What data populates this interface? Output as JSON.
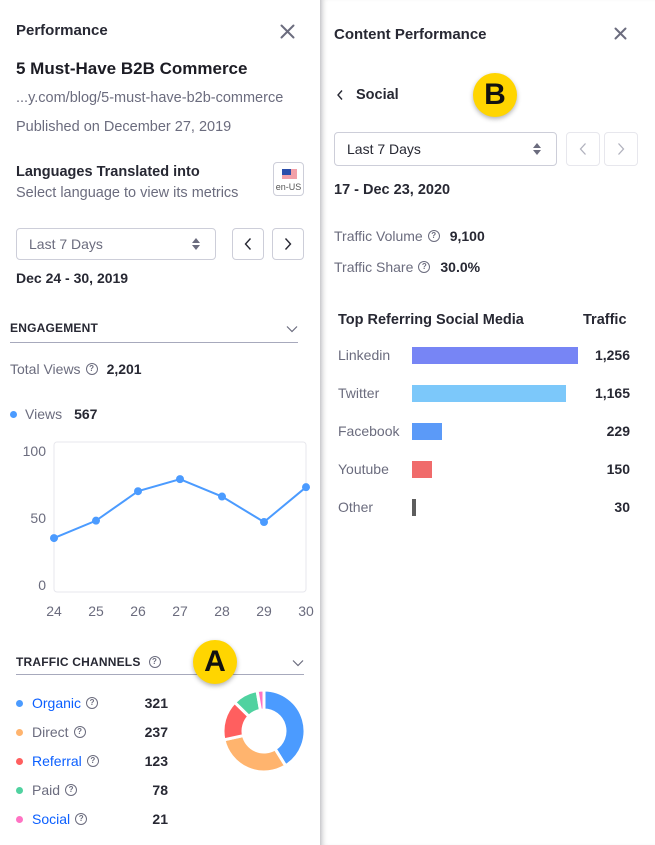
{
  "left": {
    "header_title": "Performance",
    "article_title": "5 Must-Have B2B Commerce",
    "url": "...y.com/blog/5-must-have-b2b-commerce",
    "published": "Published on December 27, 2019",
    "languages_title": "Languages Translated into",
    "languages_subtitle": "Select language to view its metrics",
    "language_badge": "en-US",
    "time_select": "Last 7 Days",
    "date_range": "Dec 24 -  30, 2019",
    "engagement": {
      "title": "ENGAGEMENT",
      "total_views_label": "Total Views",
      "total_views_value": "2,201",
      "legend_label": "Views",
      "legend_value": "567"
    },
    "traffic_channels": {
      "title": "TRAFFIC CHANNELS",
      "channels": [
        {
          "name": "Organic",
          "value": "321",
          "color": "#4b9bff",
          "link": true
        },
        {
          "name": "Direct",
          "value": "237",
          "color": "#ffb46e",
          "link": false
        },
        {
          "name": "Referral",
          "value": "123",
          "color": "#ff5f5f",
          "link": true
        },
        {
          "name": "Paid",
          "value": "78",
          "color": "#50d2a0",
          "link": false
        },
        {
          "name": "Social",
          "value": "21",
          "color": "#ff73c3",
          "link": true
        }
      ]
    },
    "annotation_badge": "A"
  },
  "right": {
    "header_title": "Content Performance",
    "back_label": "Social",
    "time_select": "Last 7 Days",
    "date_range": "17 - Dec 23, 2020",
    "traffic_volume_label": "Traffic Volume",
    "traffic_volume_value": "9,100",
    "traffic_share_label": "Traffic Share",
    "traffic_share_value": "30.0%",
    "table_header_source": "Top Referring Social Media",
    "table_header_traffic": "Traffic",
    "annotation_badge": "B"
  },
  "chart_data": [
    {
      "type": "line",
      "title": "Views",
      "categories": [
        "24",
        "25",
        "26",
        "27",
        "28",
        "29",
        "30"
      ],
      "series": [
        {
          "name": "Views",
          "values": [
            35,
            48,
            70,
            79,
            66,
            47,
            73
          ],
          "color": "#4b9bff"
        }
      ],
      "yticks": [
        "0",
        "50",
        "100"
      ],
      "ylim": [
        0,
        100
      ],
      "xlabel": "",
      "ylabel": ""
    },
    {
      "type": "pie",
      "title": "Traffic Channels",
      "categories": [
        "Organic",
        "Direct",
        "Referral",
        "Paid",
        "Social"
      ],
      "values": [
        321,
        237,
        123,
        78,
        21
      ],
      "colors": [
        "#4b9bff",
        "#ffb46e",
        "#ff5f5f",
        "#50d2a0",
        "#ff73c3"
      ]
    },
    {
      "type": "bar",
      "title": "Top Referring Social Media",
      "categories": [
        "Linkedin",
        "Twitter",
        "Facebook",
        "Youtube",
        "Other"
      ],
      "values": [
        1256,
        1165,
        229,
        150,
        30
      ],
      "labels": [
        "1,256",
        "1,165",
        "229",
        "150",
        "30"
      ],
      "colors": [
        "#7785f5",
        "#7cc8fa",
        "#5b9af8",
        "#f06b6b",
        "#5d5d5d"
      ],
      "xlim": [
        0,
        1256
      ]
    }
  ]
}
